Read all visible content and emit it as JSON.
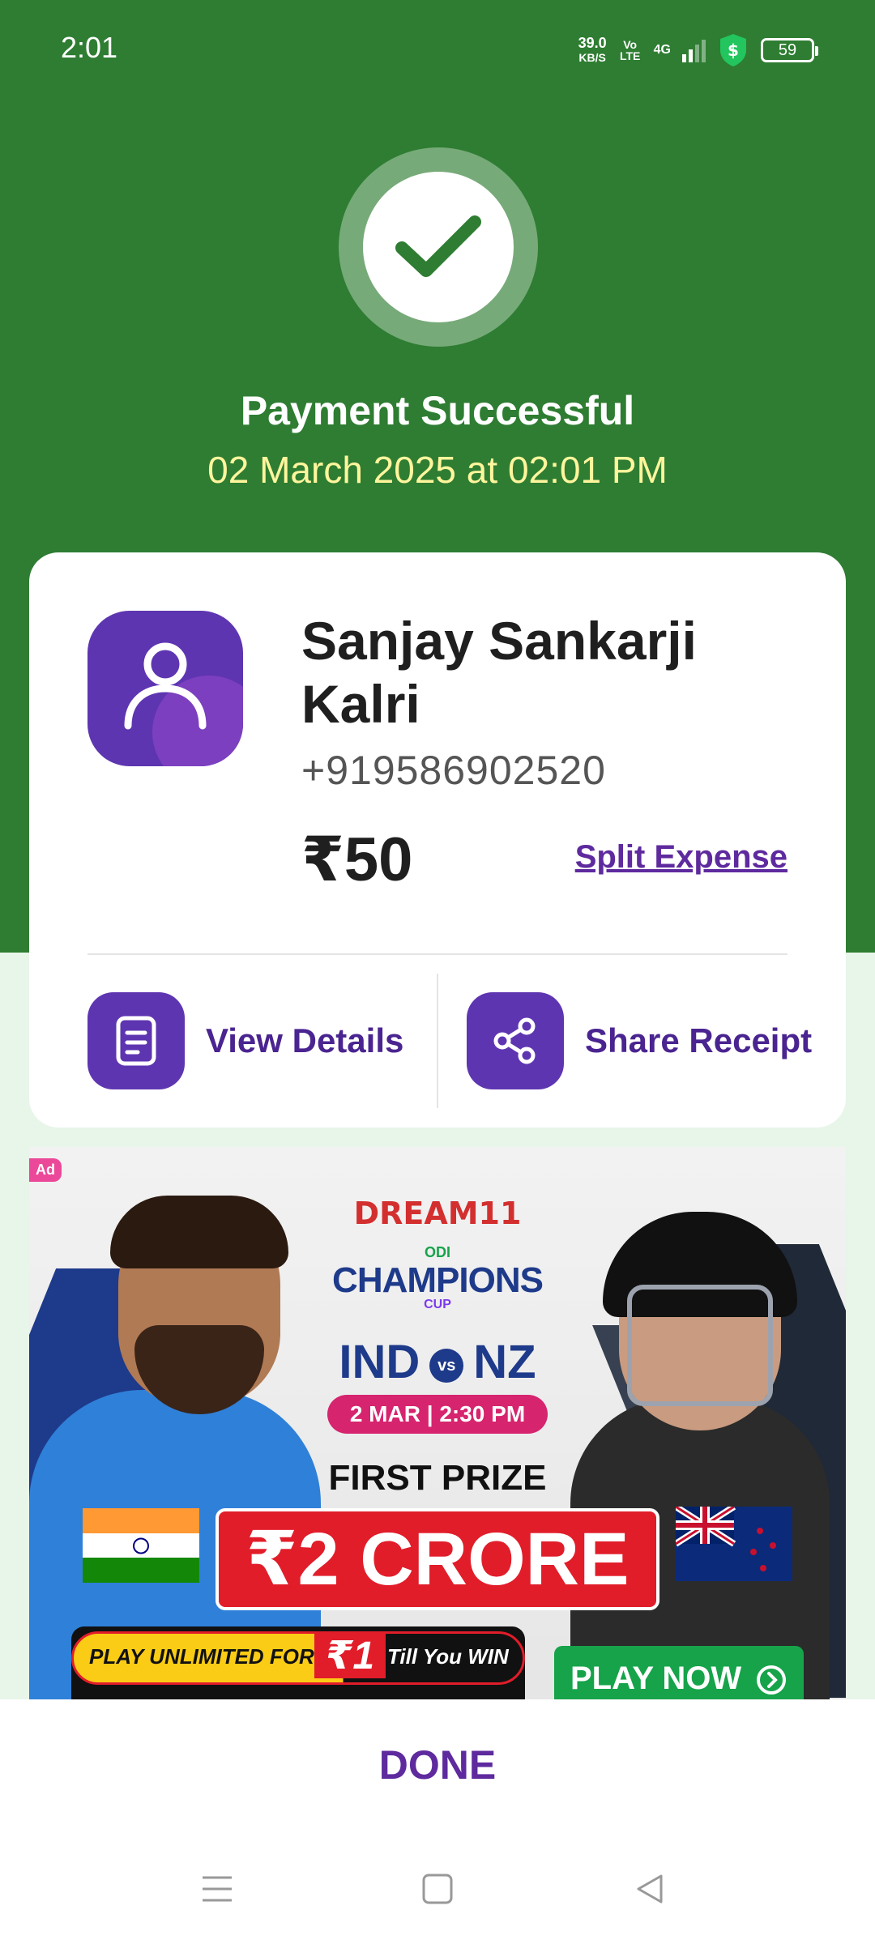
{
  "status_bar": {
    "time": "2:01",
    "net_speed": "39.0",
    "net_unit": "KB/S",
    "volte": "Vo LTE",
    "network": "4G",
    "battery": "59"
  },
  "header": {
    "title": "Payment Successful",
    "datetime": "02 March 2025 at 02:01 PM"
  },
  "payee": {
    "name": "Sanjay Sankarji Kalri",
    "phone": "+919586902520",
    "amount": "₹50",
    "split_label": "Split Expense"
  },
  "actions": {
    "view_details": "View Details",
    "share_receipt": "Share Receipt"
  },
  "ad": {
    "badge": "Ad",
    "brand": "DREAM11",
    "odi": "ODI",
    "tournament": "CHAMPIONS",
    "cup": "CUP",
    "team1": "IND",
    "vs": "vs",
    "team2": "NZ",
    "date": "2 MAR | 2:30 PM",
    "first_prize": "FIRST PRIZE",
    "prize": "₹2 CRORE",
    "play_unlimited": "PLAY UNLIMITED FOR",
    "play_amount": "₹1",
    "till_win": "Till You WIN",
    "play_now": "PLAY NOW"
  },
  "footer": {
    "done_label": "DONE"
  },
  "colors": {
    "header_green": "#2e7d32",
    "accent_purple": "#5e35b1",
    "date_yellow": "#fff59d"
  }
}
